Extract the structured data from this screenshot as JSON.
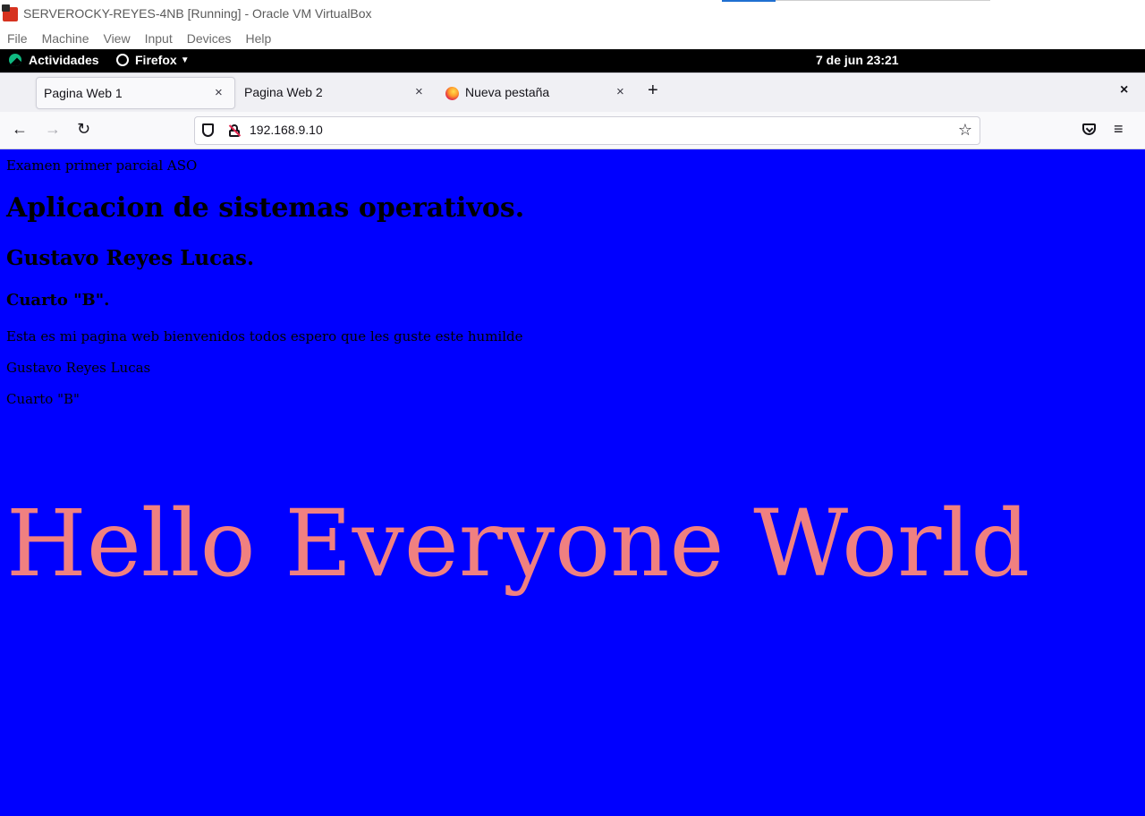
{
  "vbox": {
    "title": "SERVEROCKY-REYES-4NB [Running] - Oracle VM VirtualBox",
    "menu": [
      "File",
      "Machine",
      "View",
      "Input",
      "Devices",
      "Help"
    ]
  },
  "gnome": {
    "activities": "Actividades",
    "app_menu": "Firefox",
    "clock": "7 de jun  23:21"
  },
  "firefox": {
    "tabs": [
      {
        "label": "Pagina Web 1",
        "close": "×"
      },
      {
        "label": "Pagina Web 2",
        "close": "×"
      },
      {
        "label": "Nueva pestaña",
        "close": "×"
      }
    ],
    "new_tab": "+",
    "close_window": "×",
    "nav": {
      "back": "←",
      "forward": "→",
      "reload": "↻",
      "star": "☆",
      "menu": "≡"
    },
    "url": "192.168.9.10"
  },
  "page": {
    "background_color": "#0000ff",
    "exam_line": "Examen primer parcial ASO",
    "h1": "Aplicacion de sistemas operativos.",
    "h2": "Gustavo Reyes Lucas.",
    "h3": "Cuarto \"B\".",
    "p1": "Esta es mi pagina web bienvenidos todos espero que les guste este humilde",
    "p2": "Gustavo Reyes Lucas",
    "p3": "Cuarto \"B\"",
    "hello": "Hello Everyone World",
    "hello_color": "#f08080"
  }
}
